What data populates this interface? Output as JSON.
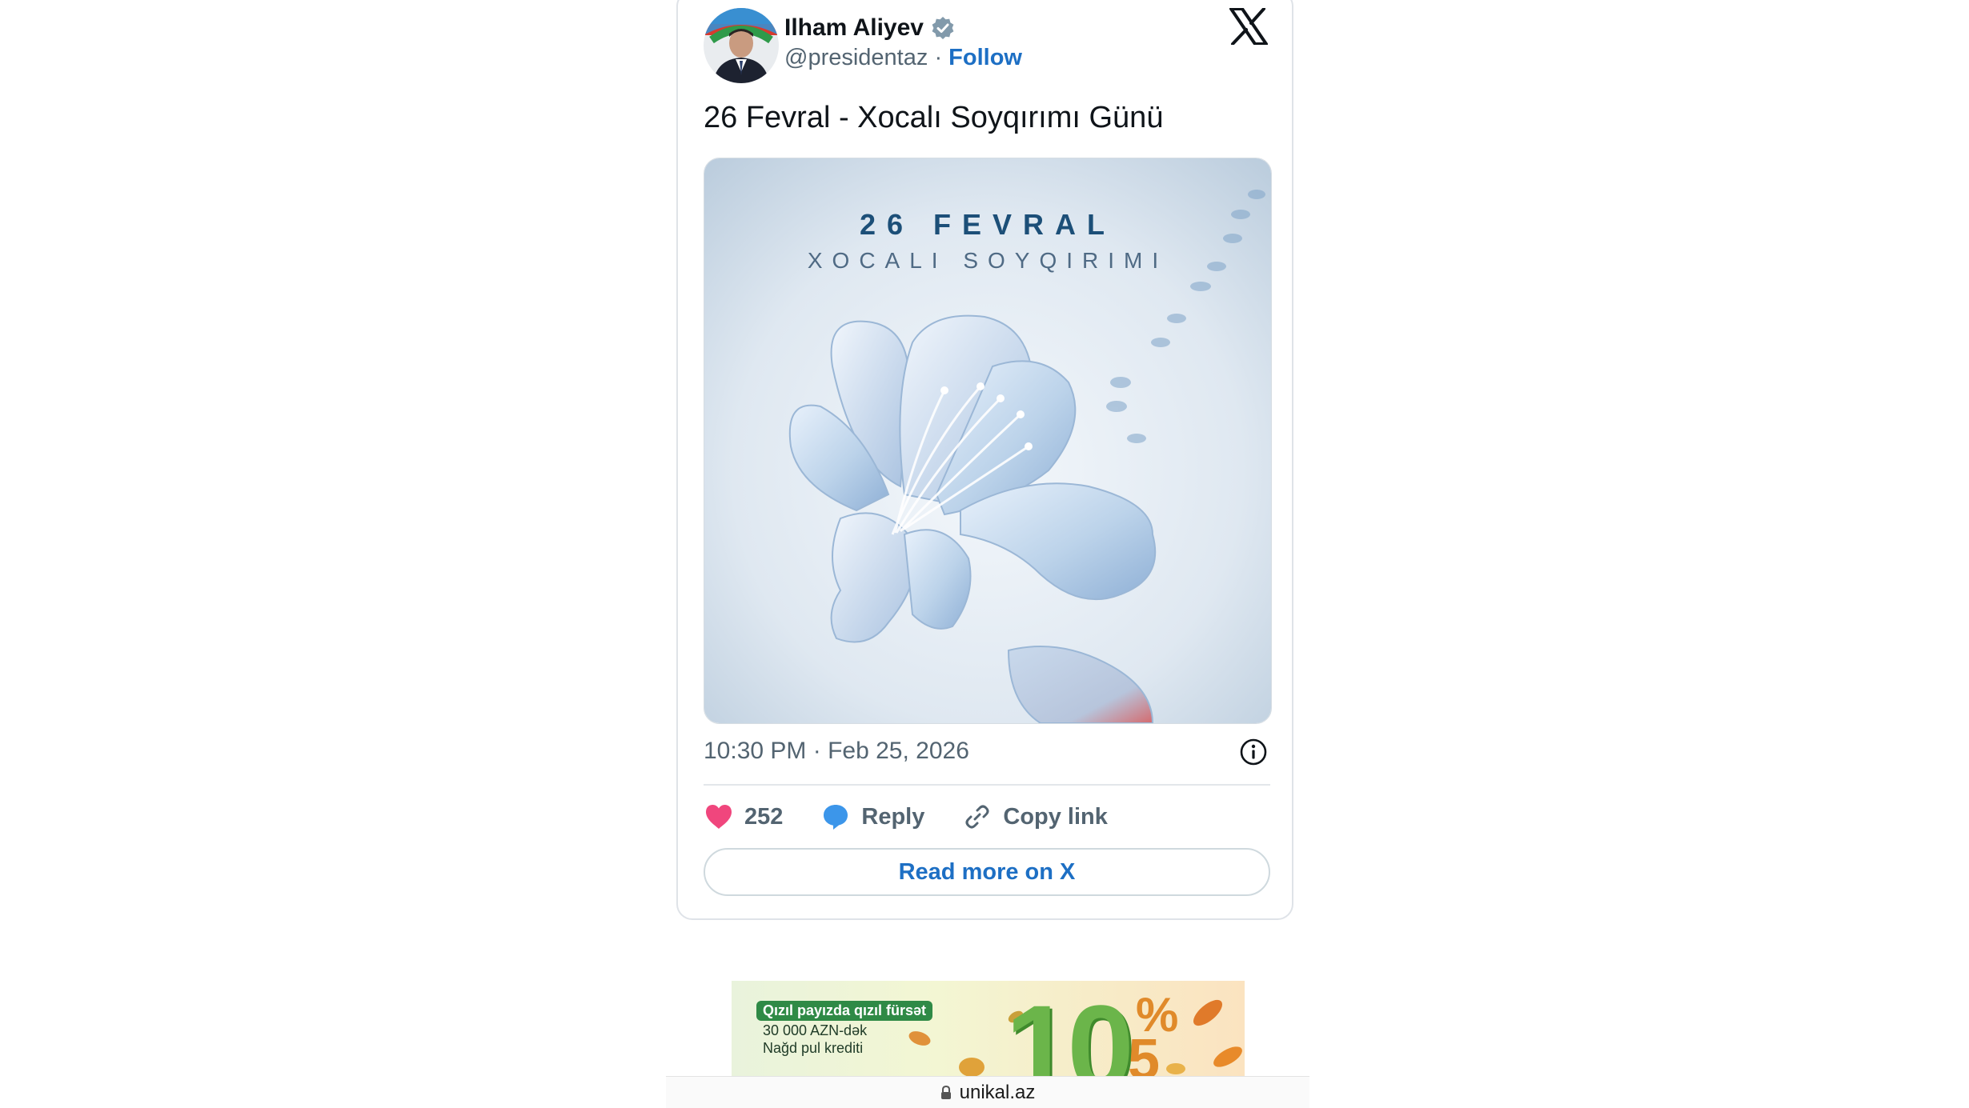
{
  "tweet": {
    "author_name": "Ilham Aliyev",
    "handle": "@presidentaz",
    "separator": "·",
    "follow_label": "Follow",
    "text": "26 Fevral - Xocalı Soyqırımı Günü",
    "image": {
      "title": "26 FEVRAL",
      "subtitle": "XOCALI SOYQIRIMI"
    },
    "timestamp": "10:30 PM · Feb 25, 2026",
    "likes": "252",
    "reply_label": "Reply",
    "copy_link_label": "Copy link",
    "read_more_label": "Read more on X",
    "colors": {
      "like": "#f0467d",
      "reply": "#3c96ea",
      "link": "#1d6fc4",
      "verified": "#829aab"
    }
  },
  "ad": {
    "tag": "Qızıl payızda qızıl fürsət",
    "line2": "30 000 AZN-dək",
    "line3": "Nağd pul krediti",
    "big_number": "10",
    "percent_sign": "%",
    "small_number": "5"
  },
  "browser": {
    "url": "unikal.az"
  }
}
